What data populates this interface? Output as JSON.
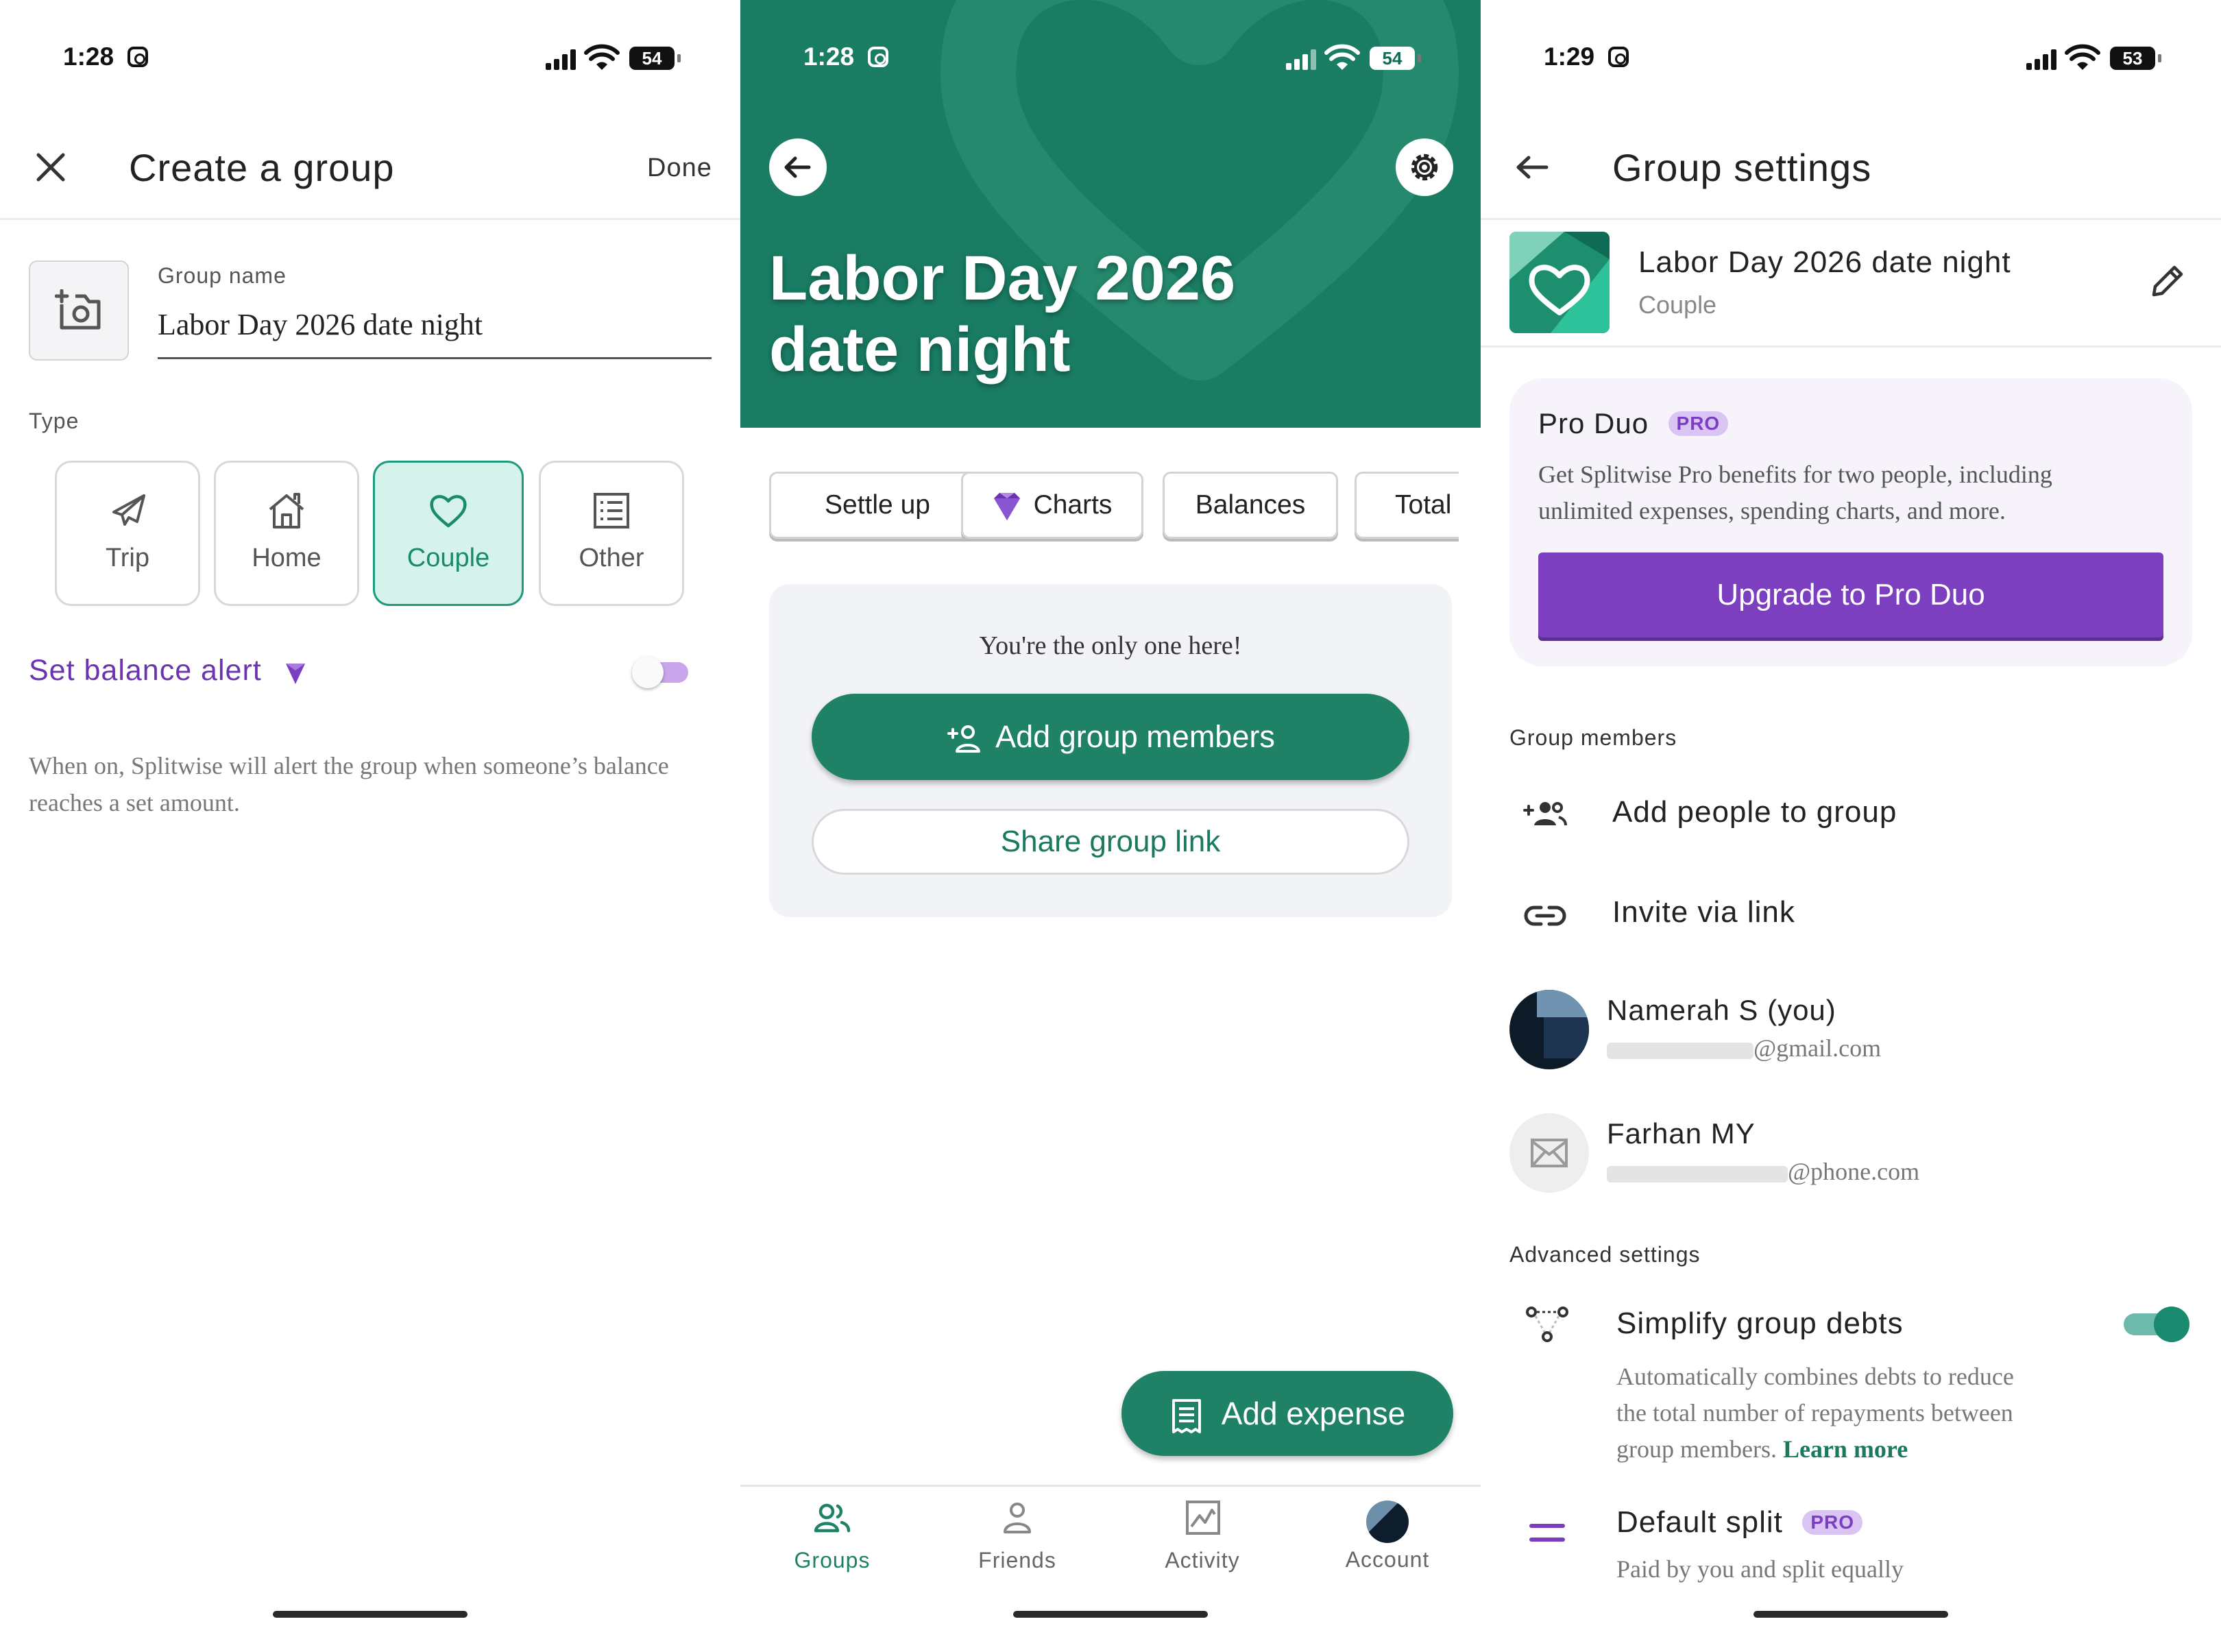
{
  "panel1": {
    "status": {
      "time": "1:28",
      "battery": "54"
    },
    "header": {
      "title": "Create a group",
      "done_label": "Done"
    },
    "form": {
      "group_name_label": "Group name",
      "group_name_value": "Labor Day 2026 date night"
    },
    "type": {
      "label": "Type",
      "options": [
        {
          "label": "Trip",
          "icon": "airplane-icon"
        },
        {
          "label": "Home",
          "icon": "home-icon"
        },
        {
          "label": "Couple",
          "icon": "heart-icon"
        },
        {
          "label": "Other",
          "icon": "list-icon"
        }
      ],
      "selected": "Couple"
    },
    "balance_alert": {
      "label": "Set balance alert",
      "enabled": false,
      "description": "When on, Splitwise will alert the group when someone’s balance reaches a set amount."
    }
  },
  "panel2": {
    "status": {
      "time": "1:28",
      "battery": "54"
    },
    "hero": {
      "title_line1": "Labor Day 2026",
      "title_line2": "date night",
      "color": "#197c63"
    },
    "actions": [
      {
        "label": "Settle up"
      },
      {
        "label": "Charts"
      },
      {
        "label": "Balances"
      },
      {
        "label": "Total"
      }
    ],
    "empty": {
      "message": "You're the only one here!",
      "add_members_label": "Add group members",
      "share_link_label": "Share group link"
    },
    "fab": {
      "label": "Add expense"
    },
    "nav": [
      {
        "label": "Groups",
        "active": true
      },
      {
        "label": "Friends",
        "active": false
      },
      {
        "label": "Activity",
        "active": false
      },
      {
        "label": "Account",
        "active": false
      }
    ]
  },
  "panel3": {
    "status": {
      "time": "1:29",
      "battery": "53"
    },
    "header": {
      "title": "Group settings"
    },
    "group": {
      "name": "Labor Day 2026 date night",
      "type": "Couple"
    },
    "pro": {
      "title": "Pro Duo",
      "badge": "PRO",
      "description_line1": "Get Splitwise Pro benefits for two people, including",
      "description_line2": "unlimited expenses, spending charts, and more.",
      "button_label": "Upgrade to Pro Duo"
    },
    "members": {
      "section_label": "Group members",
      "add_people_label": "Add people to group",
      "invite_link_label": "Invite via link",
      "list": [
        {
          "name": "Namerah S (you)",
          "email_suffix": "@gmail.com"
        },
        {
          "name": "Farhan MY",
          "email_suffix": "@phone.com"
        }
      ]
    },
    "advanced": {
      "section_label": "Advanced settings",
      "simplify": {
        "label": "Simplify group debts",
        "enabled": true,
        "description_line1": "Automatically combines debts to reduce",
        "description_line2": "the total number of repayments between",
        "description_line3": "group members.",
        "learn_more": "Learn more"
      },
      "default_split": {
        "label": "Default split",
        "badge": "PRO",
        "description": "Paid by you and split equally"
      }
    },
    "colors": {
      "accent_green": "#1f8266",
      "pro_purple": "#7b3fbf"
    }
  }
}
